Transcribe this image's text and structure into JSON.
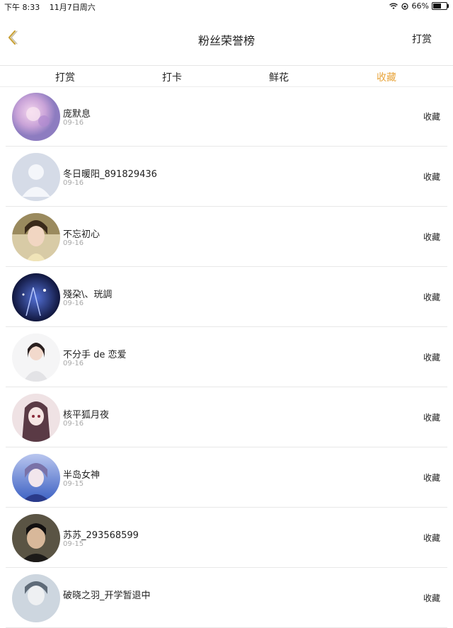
{
  "status_bar": {
    "time": "下午 8:33",
    "date": "11月7日周六",
    "battery": "66%",
    "battery_level": 0.66
  },
  "header": {
    "title": "粉丝荣誉榜",
    "action_label": "打赏",
    "accent_color": "#e8a53d"
  },
  "tabs": [
    {
      "label": "打赏",
      "active": false
    },
    {
      "label": "打卡",
      "active": false
    },
    {
      "label": "鲜花",
      "active": false
    },
    {
      "label": "收藏",
      "active": true
    }
  ],
  "list": [
    {
      "name": "庞默息",
      "date": "09-16",
      "action": "收藏",
      "avatar_colors": [
        "#e9c7e6",
        "#b69ad8"
      ]
    },
    {
      "name": "冬日暖阳_891829436",
      "date": "09-16",
      "action": "收藏",
      "avatar_colors": [
        "#d7dde9",
        "#c3cbd9"
      ]
    },
    {
      "name": "不忘初心",
      "date": "09-16",
      "action": "收藏",
      "avatar_colors": [
        "#d9c7a4",
        "#6b5a3a"
      ]
    },
    {
      "name": "殘朶\\、珖調",
      "date": "09-16",
      "action": "收藏",
      "avatar_colors": [
        "#2a3f8e",
        "#141b45"
      ]
    },
    {
      "name": "不分手 de 恋爱",
      "date": "09-16",
      "action": "收藏",
      "avatar_colors": [
        "#f3f3f3",
        "#cfcfd4"
      ]
    },
    {
      "name": "核平狐月夜",
      "date": "09-16",
      "action": "收藏",
      "avatar_colors": [
        "#eddde0",
        "#4a2d35"
      ]
    },
    {
      "name": "半岛女神",
      "date": "09-15",
      "action": "收藏",
      "avatar_colors": [
        "#9ab2e6",
        "#5a4f8c"
      ]
    },
    {
      "name": "苏苏_293568599",
      "date": "09-15",
      "action": "收藏",
      "avatar_colors": [
        "#4f4a3a",
        "#1a1712"
      ]
    },
    {
      "name": "破晓之羽_开学暂退中",
      "date": "",
      "action": "收藏",
      "avatar_colors": [
        "#c9d4de",
        "#7a8896"
      ]
    }
  ]
}
